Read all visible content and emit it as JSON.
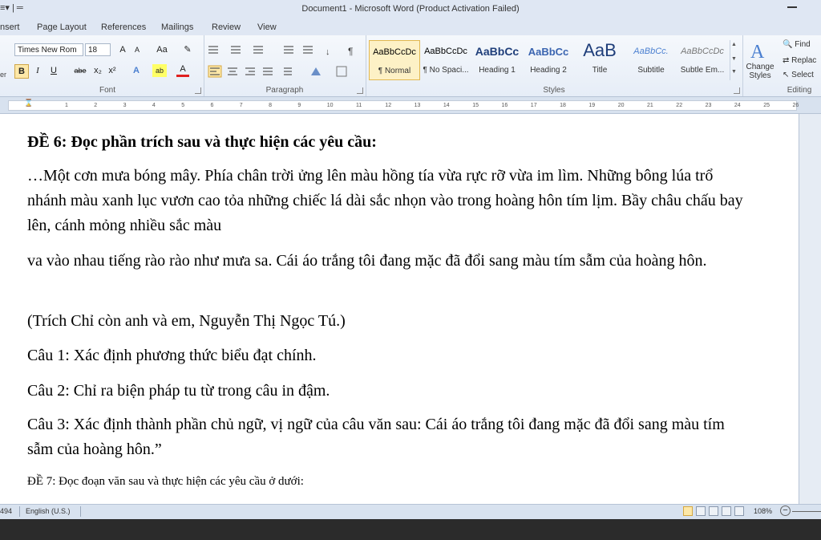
{
  "window": {
    "qat": "≡▾ | ═",
    "title": "Document1 - Microsoft Word (Product Activation Failed)"
  },
  "tabs": [
    "nsert",
    "Page Layout",
    "References",
    "Mailings",
    "Review",
    "View"
  ],
  "ribbon": {
    "font": {
      "label": "Font",
      "family": "Times New Rom",
      "size": "18",
      "grow": "A",
      "shrink": "A",
      "case": "Aa",
      "clear": "✎",
      "bold": "B",
      "italic": "I",
      "underline": "U",
      "strike": "abe",
      "subscript": "x₂",
      "superscript": "x²",
      "effects": "A",
      "highlight": "ab",
      "color": "A"
    },
    "paragraph": {
      "label": "Paragraph"
    },
    "styles": {
      "label": "Styles",
      "items": [
        {
          "sample": "AaBbCcDc",
          "name": "¶ Normal"
        },
        {
          "sample": "AaBbCcDc",
          "name": "¶ No Spaci..."
        },
        {
          "sample": "AaBbCc",
          "name": "Heading 1"
        },
        {
          "sample": "AaBbCc",
          "name": "Heading 2"
        },
        {
          "sample": "AaB",
          "name": "Title"
        },
        {
          "sample": "AaBbCc.",
          "name": "Subtitle"
        },
        {
          "sample": "AaBbCcDc",
          "name": "Subtle Em..."
        }
      ],
      "change_styles": "Change Styles"
    },
    "editing": {
      "label": "Editing",
      "find": "Find",
      "replace": "Replac",
      "select": "Select"
    },
    "left_edge": "er"
  },
  "ruler": {
    "labels": [
      "1",
      "2",
      "3",
      "4",
      "5",
      "6",
      "7",
      "8",
      "9",
      "10",
      "11",
      "12",
      "13",
      "14",
      "15",
      "16",
      "17",
      "18",
      "19",
      "20",
      "21",
      "22",
      "23",
      "24",
      "25",
      "26"
    ]
  },
  "document": {
    "heading": "ĐỀ 6: Đọc phần trích sau và thực hiện các yêu cầu:",
    "p1": "…Một cơn mưa bóng mây. Phía chân trời ửng lên màu hồng tía vừa rực rỡ vừa im lìm. Những bông lúa trổ nhánh màu xanh lục vươn cao tỏa những chiếc lá dài sắc nhọn vào trong hoàng hôn tím lịm. Bầy châu chấu bay lên, cánh mỏng nhiều sắc màu",
    "p2": "va vào nhau tiếng rào rào như mưa sa. Cái áo trắng tôi đang mặc đã đổi sang màu tím sẫm của hoàng hôn.",
    "p3": "(Trích Chỉ còn anh và em, Nguyễn Thị Ngọc Tú.)",
    "q1": "Câu 1: Xác định phương thức biểu đạt chính.",
    "q2": "Câu 2: Chỉ ra biện pháp tu từ trong câu in đậm.",
    "q3": "Câu 3: Xác định thành phần chủ ngữ, vị ngữ của câu văn sau: Cái áo trắng tôi đang mặc đã đổi sang màu tím sẫm của hoàng hôn.”",
    "p4": "ĐỀ 7: Đọc đoạn văn sau và thực hiện các yêu cầu ở dưới:"
  },
  "status": {
    "words": "494",
    "language": "English (U.S.)",
    "zoom": "108%"
  }
}
